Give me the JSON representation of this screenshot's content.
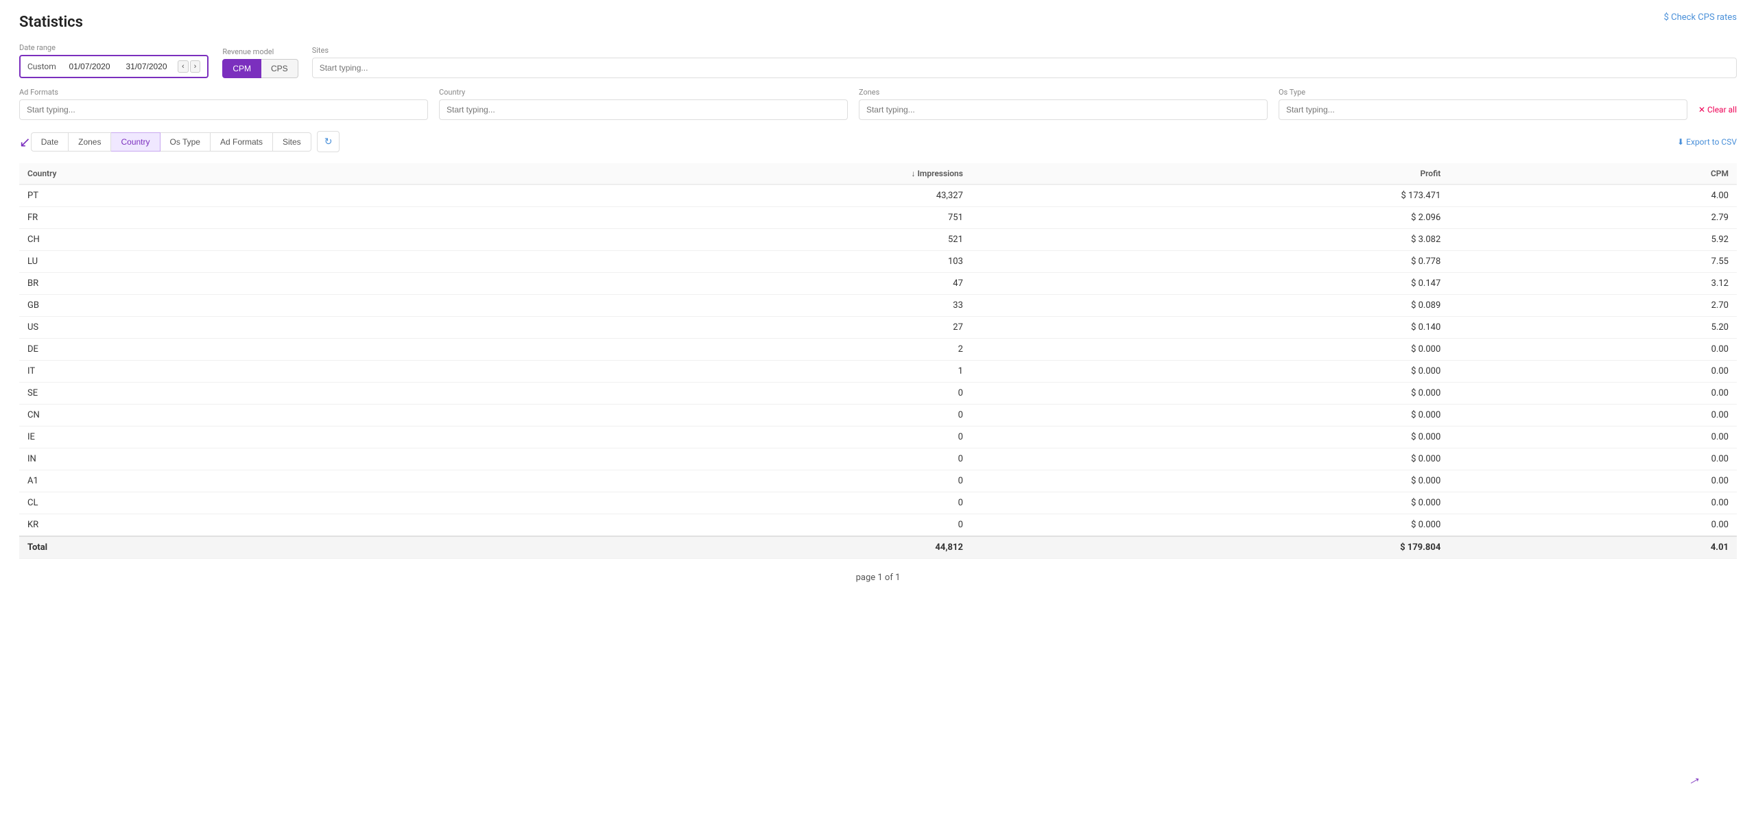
{
  "page": {
    "title": "Statistics",
    "check_cps_label": "$ Check CPS rates"
  },
  "filters": {
    "date_range_label": "Date range",
    "date_type": "Custom",
    "date_from": "01/07/2020",
    "date_to": "31/07/2020",
    "revenue_model_label": "Revenue model",
    "cpm_label": "CPM",
    "cps_label": "CPS",
    "sites_label": "Sites",
    "sites_placeholder": "Start typing...",
    "ad_formats_label": "Ad Formats",
    "ad_formats_placeholder": "Start typing...",
    "country_label": "Country",
    "country_placeholder": "Start typing...",
    "zones_label": "Zones",
    "zones_placeholder": "Start typing...",
    "os_type_label": "Os Type",
    "os_type_placeholder": "Start typing...",
    "clear_all_label": "✕ Clear all"
  },
  "groupby": {
    "tabs": [
      "Date",
      "Zones",
      "Country",
      "Os Type",
      "Ad Formats",
      "Sites"
    ],
    "active": "Country"
  },
  "table": {
    "columns": [
      "Country",
      "↓ Impressions",
      "Profit",
      "CPM"
    ],
    "rows": [
      {
        "country": "PT",
        "impressions": "43,327",
        "profit": "$ 173.471",
        "cpm": "4.00"
      },
      {
        "country": "FR",
        "impressions": "751",
        "profit": "$ 2.096",
        "cpm": "2.79"
      },
      {
        "country": "CH",
        "impressions": "521",
        "profit": "$ 3.082",
        "cpm": "5.92"
      },
      {
        "country": "LU",
        "impressions": "103",
        "profit": "$ 0.778",
        "cpm": "7.55"
      },
      {
        "country": "BR",
        "impressions": "47",
        "profit": "$ 0.147",
        "cpm": "3.12"
      },
      {
        "country": "GB",
        "impressions": "33",
        "profit": "$ 0.089",
        "cpm": "2.70"
      },
      {
        "country": "US",
        "impressions": "27",
        "profit": "$ 0.140",
        "cpm": "5.20"
      },
      {
        "country": "DE",
        "impressions": "2",
        "profit": "$ 0.000",
        "cpm": "0.00"
      },
      {
        "country": "IT",
        "impressions": "1",
        "profit": "$ 0.000",
        "cpm": "0.00"
      },
      {
        "country": "SE",
        "impressions": "0",
        "profit": "$ 0.000",
        "cpm": "0.00"
      },
      {
        "country": "CN",
        "impressions": "0",
        "profit": "$ 0.000",
        "cpm": "0.00"
      },
      {
        "country": "IE",
        "impressions": "0",
        "profit": "$ 0.000",
        "cpm": "0.00"
      },
      {
        "country": "IN",
        "impressions": "0",
        "profit": "$ 0.000",
        "cpm": "0.00"
      },
      {
        "country": "A1",
        "impressions": "0",
        "profit": "$ 0.000",
        "cpm": "0.00"
      },
      {
        "country": "CL",
        "impressions": "0",
        "profit": "$ 0.000",
        "cpm": "0.00"
      },
      {
        "country": "KR",
        "impressions": "0",
        "profit": "$ 0.000",
        "cpm": "0.00"
      }
    ],
    "total": {
      "label": "Total",
      "impressions": "44,812",
      "profit": "$ 179.804",
      "cpm": "4.01"
    }
  },
  "pagination": {
    "label": "page 1 of 1"
  },
  "export": {
    "label": "⬇ Export to CSV"
  },
  "refresh_icon": "↻"
}
